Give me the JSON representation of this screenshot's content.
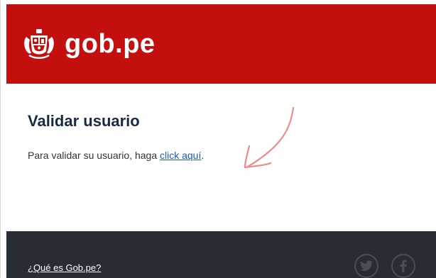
{
  "header": {
    "logo_text": "gob.pe",
    "background_color": "#c3100f"
  },
  "main": {
    "title": "Validar usuario",
    "message_prefix": "Para validar su usuario, haga ",
    "link_text": "click aquí",
    "message_suffix": "."
  },
  "footer": {
    "link_text": "¿Qué es Gob.pe?",
    "social_icons": [
      "twitter-icon",
      "facebook-icon"
    ],
    "background_color": "#282c34"
  },
  "annotation": {
    "type": "hand-drawn arrow",
    "color": "#f08a8a"
  }
}
